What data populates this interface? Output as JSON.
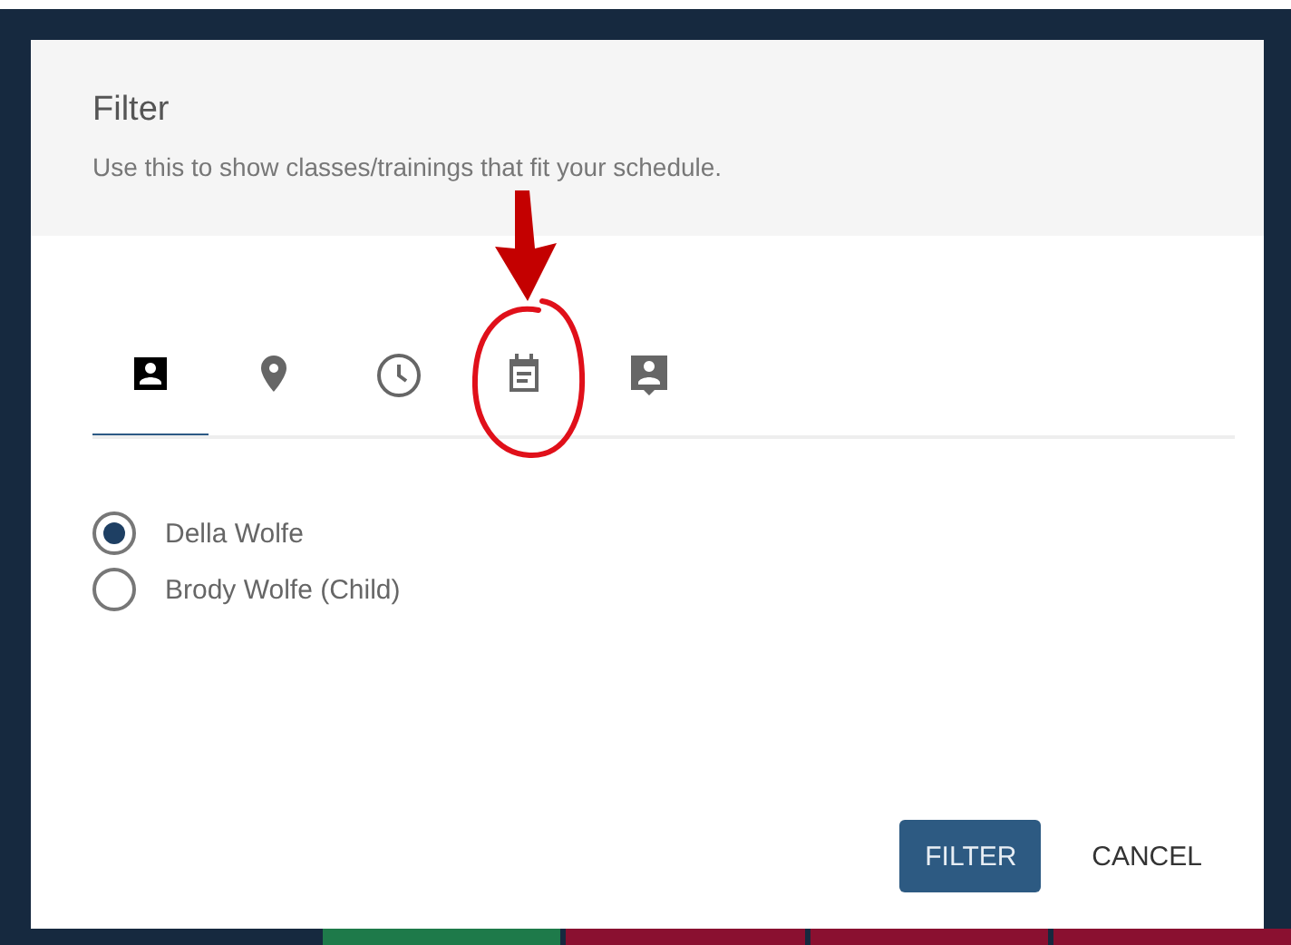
{
  "dialog": {
    "title": "Filter",
    "subtitle": "Use this to show classes/trainings that fit your schedule."
  },
  "tabs": [
    {
      "kind": "person",
      "selected": true
    },
    {
      "kind": "place",
      "selected": false
    },
    {
      "kind": "clock",
      "selected": false
    },
    {
      "kind": "calendar",
      "selected": false
    },
    {
      "kind": "contact",
      "selected": false
    }
  ],
  "people": [
    {
      "name": "Della Wolfe",
      "selected": true
    },
    {
      "name": "Brody Wolfe (Child)",
      "selected": false
    }
  ],
  "buttons": [
    {
      "label": "FILTER",
      "kind": "primary"
    },
    {
      "label": "CANCEL",
      "kind": "text"
    }
  ]
}
